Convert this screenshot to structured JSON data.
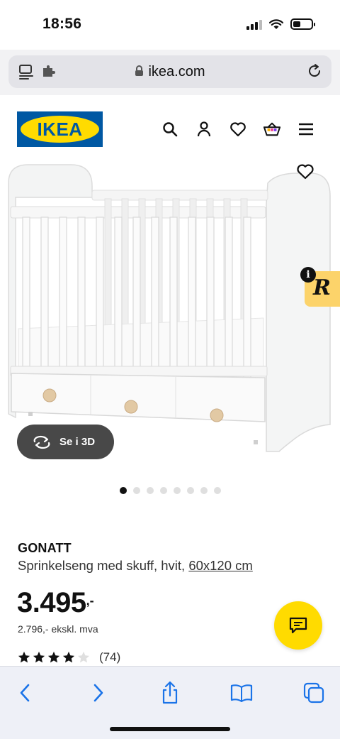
{
  "status_bar": {
    "time": "18:56"
  },
  "browser": {
    "url": "ikea.com"
  },
  "header": {
    "logo_text": "IKEA",
    "icons": [
      "search-icon",
      "user-icon",
      "heart-icon",
      "basket-icon",
      "menu-icon"
    ]
  },
  "gallery": {
    "view_3d_label": "Se i 3D",
    "dot_count": 8,
    "active_dot": 0
  },
  "product": {
    "name": "GONATT",
    "description": "Sprinkelseng med skuff, hvit, ",
    "size_link": "60x120 cm",
    "price_main": "3.495",
    "price_suffix": ",-",
    "price_ex_vat": "2.796,- ekskl. mva",
    "rating_stars": 4,
    "rating_max": 5,
    "review_count": "(74)"
  },
  "colors": {
    "ikea_blue": "#0058a3",
    "ikea_yellow": "#ffdb00",
    "safari_accent": "#1a73e8"
  }
}
